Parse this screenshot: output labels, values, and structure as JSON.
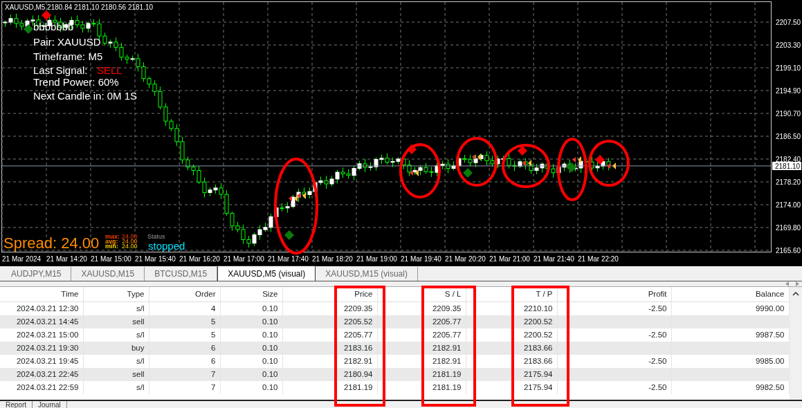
{
  "chart": {
    "header": {
      "symbol": "XAUUSD,M5",
      "quotes": [
        "2180.84",
        "2181.10",
        "2180.56",
        "2181.10"
      ]
    },
    "info": {
      "title": "bbbbbbb",
      "pair": "Pair: XAUUSD",
      "timeframe": "Timeframe: M5",
      "signal_label": "Last Signal:",
      "signal": "SELL",
      "trend_power": "Trend Power: 60%",
      "next_candle": "Next Candle in: 0M 1S"
    },
    "spread": {
      "text": "Spread: 24.00",
      "stats": [
        {
          "label": "max:",
          "value": "24.00",
          "color": "#ff3c00"
        },
        {
          "label": "avg:",
          "value": "24.00",
          "color": "#ff8c00"
        },
        {
          "label": "min:",
          "value": "24.00",
          "color": "#ffd700"
        }
      ]
    },
    "status": {
      "label": "Status",
      "value": "stopped"
    },
    "price_axis": [
      "2207.50",
      "2203.30",
      "2199.10",
      "2194.90",
      "2190.70",
      "2186.50",
      "2182.40",
      "2178.20",
      "2174.00",
      "2169.80",
      "2165.60"
    ],
    "current_price": "2181.10",
    "time_axis": [
      "21 Mar 2024",
      "21 Mar 14:20",
      "21 Mar 15:00",
      "21 Mar 15:40",
      "21 Mar 16:20",
      "21 Mar 17:00",
      "21 Mar 17:40",
      "21 Mar 18:20",
      "21 Mar 19:00",
      "21 Mar 19:40",
      "21 Mar 20:20",
      "21 Mar 21:00",
      "21 Mar 21:40",
      "21 Mar 22:20"
    ]
  },
  "tabs": [
    {
      "label": "AUDJPY,M15",
      "selected": false
    },
    {
      "label": "XAUUSD,M15",
      "selected": false
    },
    {
      "label": "BTCUSD,M15",
      "selected": false
    },
    {
      "label": "XAUUSD,M5 (visual)",
      "selected": true
    },
    {
      "label": "XAUUSD,M15 (visual)",
      "selected": false
    }
  ],
  "table": {
    "columns": [
      "Time",
      "Type",
      "Order",
      "Size",
      "Price",
      "S / L",
      "T / P",
      "Profit",
      "Balance"
    ],
    "rows": [
      {
        "time": "2024.03.21 12:30",
        "type": "s/l",
        "order": "4",
        "size": "0.10",
        "price": "2209.35",
        "sl": "2209.35",
        "tp": "2210.10",
        "profit": "-2.50",
        "balance": "9990.00"
      },
      {
        "time": "2024.03.21 14:45",
        "type": "sell",
        "order": "5",
        "size": "0.10",
        "price": "2205.52",
        "sl": "2205.77",
        "tp": "2200.52"
      },
      {
        "time": "2024.03.21 15:00",
        "type": "s/l",
        "order": "5",
        "size": "0.10",
        "price": "2205.77",
        "sl": "2205.77",
        "tp": "2200.52",
        "profit": "-2.50",
        "balance": "9987.50"
      },
      {
        "time": "2024.03.21 19:30",
        "type": "buy",
        "order": "6",
        "size": "0.10",
        "price": "2183.16",
        "sl": "2182.91",
        "tp": "2183.66"
      },
      {
        "time": "2024.03.21 19:45",
        "type": "s/l",
        "order": "6",
        "size": "0.10",
        "price": "2182.91",
        "sl": "2182.91",
        "tp": "2183.66",
        "profit": "-2.50",
        "balance": "9985.00"
      },
      {
        "time": "2024.03.21 22:45",
        "type": "sell",
        "order": "7",
        "size": "0.10",
        "price": "2180.94",
        "sl": "2181.19",
        "tp": "2175.94"
      },
      {
        "time": "2024.03.21 22:59",
        "type": "s/l",
        "order": "7",
        "size": "0.10",
        "price": "2181.19",
        "sl": "2181.19",
        "tp": "2175.94",
        "profit": "-2.50",
        "balance": "9982.50"
      }
    ]
  },
  "bottom_tabs": [
    "Report",
    "Journal"
  ]
}
